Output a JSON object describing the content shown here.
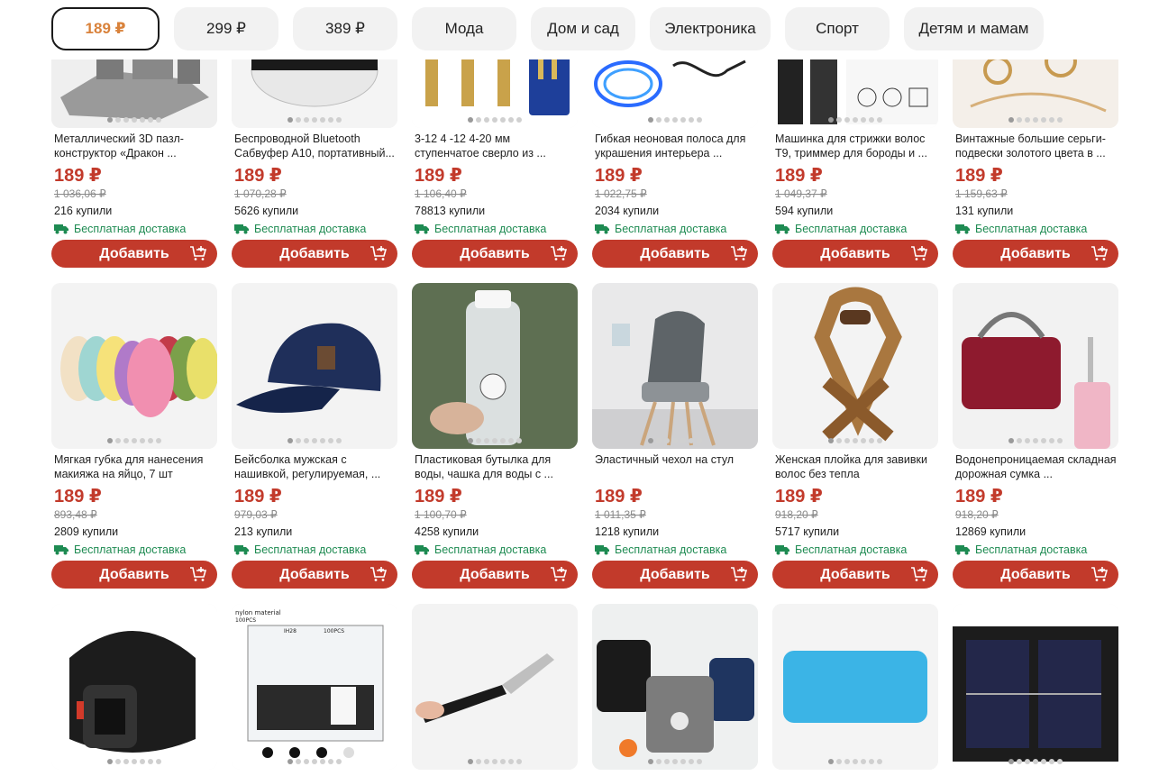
{
  "filters": [
    {
      "label": "189 ₽",
      "active": true
    },
    {
      "label": "299 ₽"
    },
    {
      "label": "389 ₽"
    },
    {
      "label": "Мода"
    },
    {
      "label": "Дом и сад"
    },
    {
      "label": "Электроника"
    },
    {
      "label": "Спорт"
    },
    {
      "label": "Детям и мамам"
    }
  ],
  "add_label": "Добавить",
  "shipping_label": "Бесплатная доставка",
  "colors": {
    "accent": "#c23a2b",
    "shipping": "#1e8b52",
    "active_chip_text": "#d9823b"
  },
  "rows": [
    [
      {
        "title": "Металлический 3D пазл-конструктор «Дракон ...",
        "price": "189 ₽",
        "old": "1 036,06 ₽",
        "bought": "216 купили",
        "image": "metal-puzzle"
      },
      {
        "title": "Беспроводной Bluetooth Сабвуфер A10, портативный...",
        "price": "189 ₽",
        "old": "1 070,28 ₽",
        "bought": "5626 купили",
        "image": "speaker"
      },
      {
        "title": "3-12 4 -12 4-20 мм ступенчатое сверло из ...",
        "price": "189 ₽",
        "old": "1 106,40 ₽",
        "bought": "78813 купили",
        "image": "drill-bits"
      },
      {
        "title": "Гибкая неоновая полоса для украшения интерьера ...",
        "price": "189 ₽",
        "old": "1 022,75 ₽",
        "bought": "2034 купили",
        "image": "neon-strip"
      },
      {
        "title": "Машинка для стрижки волос T9, триммер для бороды и ...",
        "price": "189 ₽",
        "old": "1 049,37 ₽",
        "bought": "594 купили",
        "image": "hair-clipper"
      },
      {
        "title": "Винтажные большие серьги-подвески золотого цвета в ...",
        "price": "189 ₽",
        "old": "1 159,63 ₽",
        "bought": "131 купили",
        "image": "earrings"
      }
    ],
    [
      {
        "title": "Мягкая губка для нанесения макияжа на яйцо, 7 шт",
        "price": "189 ₽",
        "old": "893,48 ₽",
        "bought": "2809 купили",
        "image": "makeup-sponges"
      },
      {
        "title": "Бейсболка мужская с нашивкой, регулируемая, ...",
        "price": "189 ₽",
        "old": "979,03 ₽",
        "bought": "213 купили",
        "image": "cap"
      },
      {
        "title": "Пластиковая бутылка для воды, чашка для воды с ...",
        "price": "189 ₽",
        "old": "1 100,70 ₽",
        "bought": "4258 купили",
        "image": "bottle"
      },
      {
        "title": "Эластичный чехол на стул",
        "price": "189 ₽",
        "old": "1 011,35 ₽",
        "bought": "1218 купили",
        "image": "chair-cover"
      },
      {
        "title": "Женская плойка для завивки волос без тепла",
        "price": "189 ₽",
        "old": "918,20 ₽",
        "bought": "5717 купили",
        "image": "heatless-curler"
      },
      {
        "title": "Водонепроницаемая складная дорожная сумка ...",
        "price": "189 ₽",
        "old": "918,20 ₽",
        "bought": "12869 купили",
        "image": "travel-bag"
      }
    ],
    [
      {
        "image": "belt"
      },
      {
        "image": "plastic-clips",
        "caption_small": "nylon material",
        "caption_count": "100PCS",
        "caption_mid1": "IH28",
        "caption_mid2": "100PCS"
      },
      {
        "image": "pry-tool"
      },
      {
        "image": "lunch-bags"
      },
      {
        "image": "silicone-mat"
      },
      {
        "image": "solar-panel"
      }
    ]
  ]
}
